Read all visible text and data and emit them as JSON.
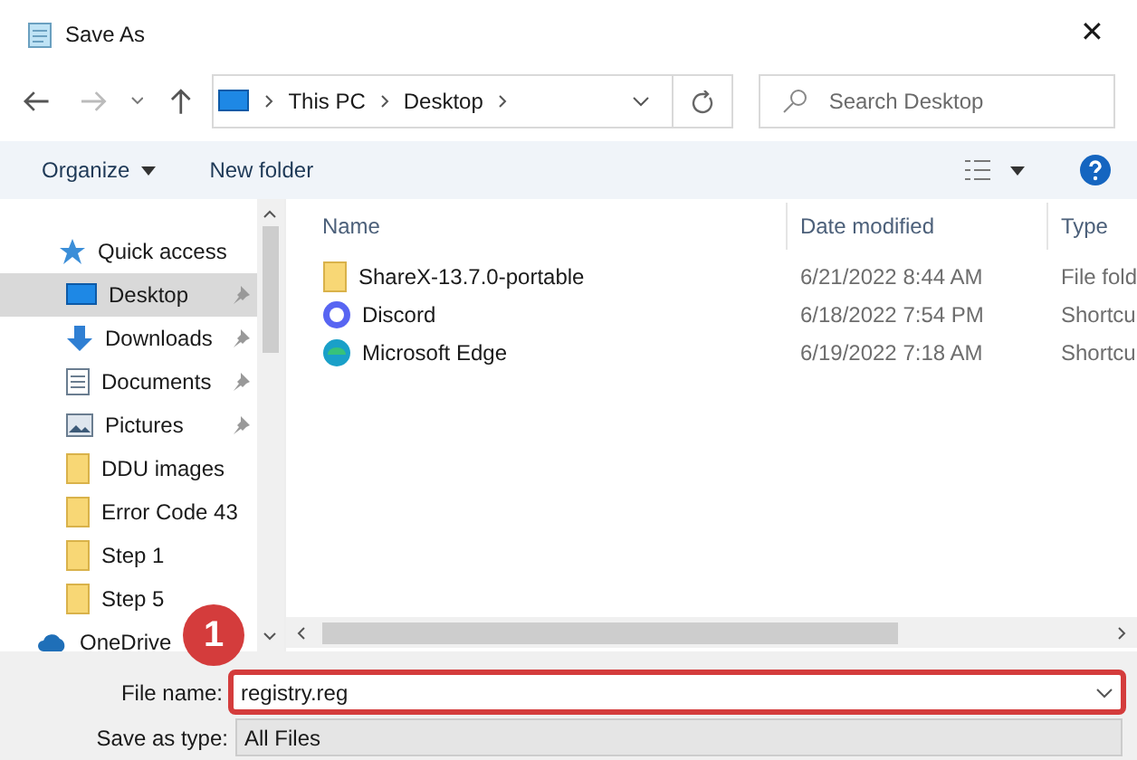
{
  "window": {
    "title": "Save As",
    "close": "✕"
  },
  "address": {
    "crumbs": [
      "This PC",
      "Desktop"
    ]
  },
  "search": {
    "placeholder": "Search Desktop"
  },
  "toolbar": {
    "organize": "Organize",
    "new_folder": "New folder"
  },
  "sidebar": {
    "items": [
      {
        "label": "Quick access",
        "kind": "star",
        "pinned": false,
        "selected": false
      },
      {
        "label": "Desktop",
        "kind": "desktop",
        "pinned": true,
        "selected": true
      },
      {
        "label": "Downloads",
        "kind": "download",
        "pinned": true,
        "selected": false
      },
      {
        "label": "Documents",
        "kind": "document",
        "pinned": true,
        "selected": false
      },
      {
        "label": "Pictures",
        "kind": "pictures",
        "pinned": true,
        "selected": false
      },
      {
        "label": "DDU images",
        "kind": "folder",
        "pinned": false,
        "selected": false
      },
      {
        "label": "Error Code 43",
        "kind": "folder",
        "pinned": false,
        "selected": false
      },
      {
        "label": "Step 1",
        "kind": "folder",
        "pinned": false,
        "selected": false
      },
      {
        "label": "Step 5",
        "kind": "folder",
        "pinned": false,
        "selected": false
      },
      {
        "label": "OneDrive",
        "kind": "cloud",
        "pinned": false,
        "selected": false
      }
    ]
  },
  "table": {
    "columns": [
      "Name",
      "Date modified",
      "Type"
    ],
    "rows": [
      {
        "name": "ShareX-13.7.0-portable",
        "kind": "folder",
        "date": "6/21/2022 8:44 AM",
        "type": "File fold"
      },
      {
        "name": "Discord",
        "kind": "discord",
        "date": "6/18/2022 7:54 PM",
        "type": "Shortcu"
      },
      {
        "name": "Microsoft Edge",
        "kind": "edge",
        "date": "6/19/2022 7:18 AM",
        "type": "Shortcu"
      }
    ]
  },
  "file_name": {
    "label": "File name:",
    "value": "registry.reg"
  },
  "save_type": {
    "label": "Save as type:",
    "value": "All Files"
  },
  "annotation": {
    "badge": "1"
  }
}
